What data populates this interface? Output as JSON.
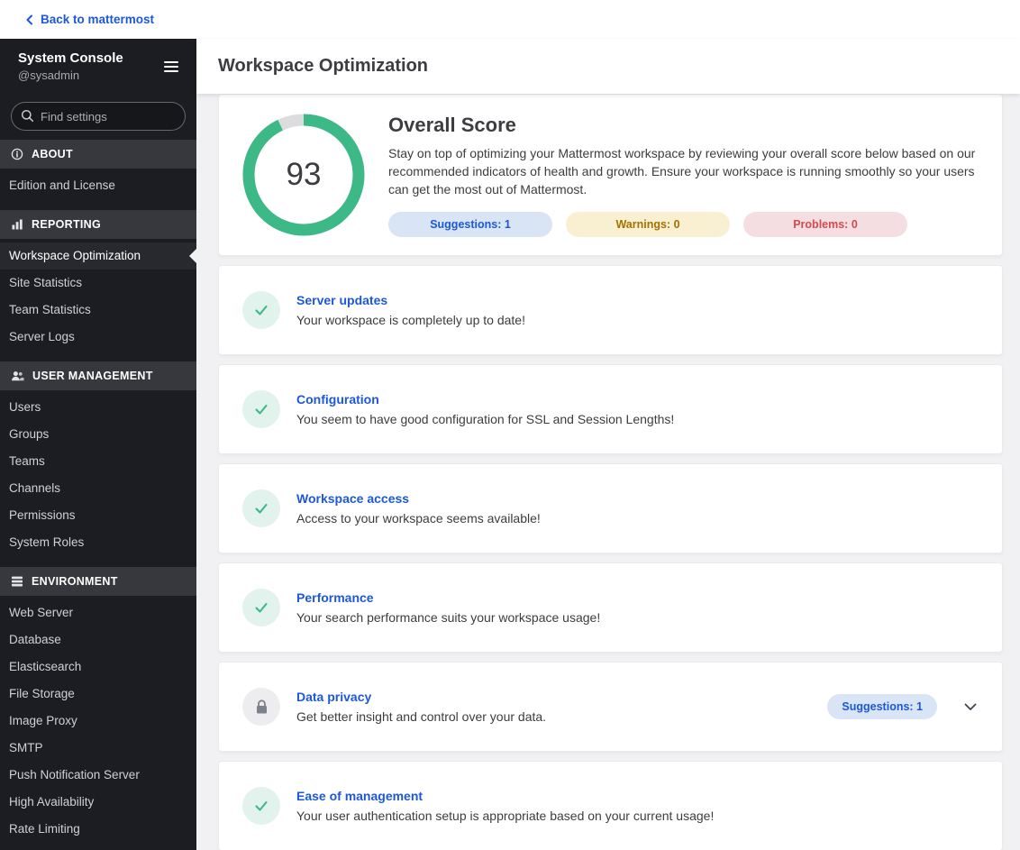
{
  "colors": {
    "accent-blue": "#1c58d9",
    "success-green": "#3db887",
    "warning-text": "#a37200",
    "warning-bg": "#f9efd1",
    "error-text": "#d24b4e",
    "error-bg": "#f5dee1",
    "info-bg": "#d9e4f4",
    "sidebar-bg": "#1b1d22",
    "sidebar-section-bg": "#36383e",
    "content-bg": "#f1f1f3",
    "text-dark": "#3d3c40"
  },
  "topbar": {
    "back_label": "Back to mattermost"
  },
  "sidebar": {
    "title": "System Console",
    "subtitle": "@sysadmin",
    "search": {
      "placeholder": "Find settings"
    },
    "sections": [
      {
        "label": "ABOUT",
        "items": [
          {
            "label": "Edition and License"
          }
        ]
      },
      {
        "label": "REPORTING",
        "items": [
          {
            "label": "Workspace Optimization"
          },
          {
            "label": "Site Statistics"
          },
          {
            "label": "Team Statistics"
          },
          {
            "label": "Server Logs"
          }
        ]
      },
      {
        "label": "USER MANAGEMENT",
        "items": [
          {
            "label": "Users"
          },
          {
            "label": "Groups"
          },
          {
            "label": "Teams"
          },
          {
            "label": "Channels"
          },
          {
            "label": "Permissions"
          },
          {
            "label": "System Roles"
          }
        ]
      },
      {
        "label": "ENVIRONMENT",
        "items": [
          {
            "label": "Web Server"
          },
          {
            "label": "Database"
          },
          {
            "label": "Elasticsearch"
          },
          {
            "label": "File Storage"
          },
          {
            "label": "Image Proxy"
          },
          {
            "label": "SMTP"
          },
          {
            "label": "Push Notification Server"
          },
          {
            "label": "High Availability"
          },
          {
            "label": "Rate Limiting"
          }
        ]
      }
    ]
  },
  "header": {
    "title": "Workspace Optimization"
  },
  "overview": {
    "score": 93,
    "title": "Overall Score",
    "description": "Stay on top of optimizing your Mattermost workspace by reviewing your overall score below based on our recommended indicators of health and growth. Ensure your workspace is running smoothly so your users can get the most out of Mattermost.",
    "badges": [
      {
        "label": "Suggestions: 1"
      },
      {
        "label": "Warnings: 0"
      },
      {
        "label": "Problems: 0"
      }
    ]
  },
  "cards": [
    {
      "title": "Server updates",
      "description": "Your workspace is completely up to date!"
    },
    {
      "title": "Configuration",
      "description": "You seem to have good configuration for SSL and Session Lengths!"
    },
    {
      "title": "Workspace access",
      "description": "Access to your workspace seems available!"
    },
    {
      "title": "Performance",
      "description": "Your search performance suits your workspace usage!"
    },
    {
      "title": "Data privacy",
      "description": "Get better insight and control over your data.",
      "badge": "Suggestions: 1"
    },
    {
      "title": "Ease of management",
      "description": "Your user authentication setup is appropriate based on your current usage!"
    }
  ]
}
